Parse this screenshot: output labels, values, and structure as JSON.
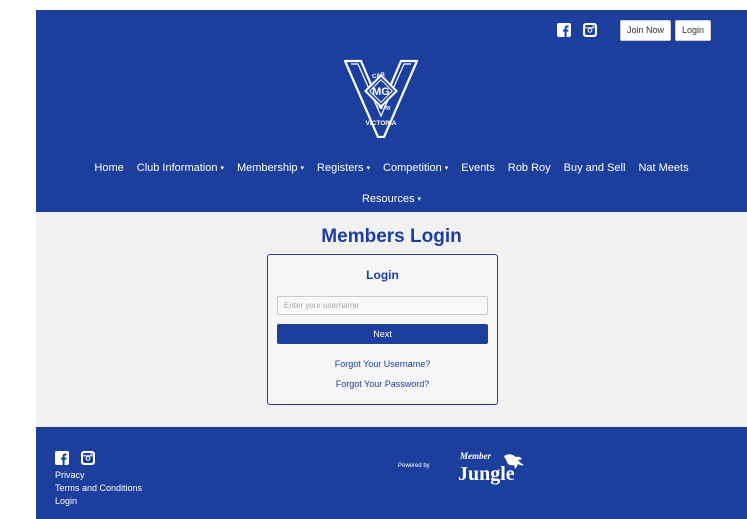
{
  "header": {
    "social": [
      "facebook-icon",
      "instagram-icon"
    ],
    "join_label": "Join Now",
    "login_label": "Login",
    "logo": {
      "top_text": "CAR",
      "club_text": "CLUB",
      "badge_text": "MG",
      "bottom_text": "VICTORIA"
    }
  },
  "nav": {
    "row1": [
      {
        "label": "Home",
        "dropdown": false
      },
      {
        "label": "Club Information",
        "dropdown": true
      },
      {
        "label": "Membership",
        "dropdown": true
      },
      {
        "label": "Registers",
        "dropdown": true
      },
      {
        "label": "Competition",
        "dropdown": true
      },
      {
        "label": "Events",
        "dropdown": false
      },
      {
        "label": "Rob Roy",
        "dropdown": false
      },
      {
        "label": "Buy and Sell",
        "dropdown": false
      },
      {
        "label": "Nat Meets",
        "dropdown": false
      }
    ],
    "row2": [
      {
        "label": "Resources",
        "dropdown": true
      }
    ],
    "caret": "▾"
  },
  "main": {
    "title": "Members Login",
    "card": {
      "title": "Login",
      "username_placeholder": "Enter your username",
      "username_value": "",
      "next_label": "Next",
      "forgot_username": "Forgot Your Username?",
      "forgot_password": "Forgot Your Password?"
    }
  },
  "footer": {
    "social": [
      "facebook-icon",
      "instagram-icon"
    ],
    "links": [
      "Privacy",
      "Terms and Conditions",
      "Login"
    ],
    "powered_by": "Powered by",
    "brand_top": "Member",
    "brand_bottom": "Jungle"
  },
  "colors": {
    "brand_blue": "#1c3f9e",
    "page_bg": "#f1f1f1",
    "white": "#ffffff"
  }
}
